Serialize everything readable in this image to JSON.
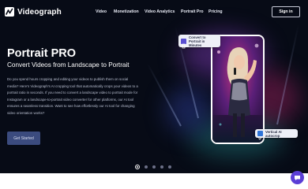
{
  "header": {
    "logo_text": "Videograph",
    "nav": [
      "Video",
      "Monetization",
      "Video Analytics",
      "Portrait Pro",
      "Pricing"
    ],
    "signin_label": "Sign in"
  },
  "hero": {
    "title": "Portrait PRO",
    "subtitle": "Convert Videos from Landscape to Portrait",
    "description": "Do you spend hours cropping and editing your videos to publish them on social media? Here's Videograph's AI cropping tool that automatically crops your videos to a portrait ratio in seconds. If you need to convert a landscape video to portrait mode for Instagram or a landscape-to-portrait video converter for other platforms, our AI tool ensures a seamless transition. Want to see how effortlessly our AI tool for changing video orientation works?",
    "cta_label": "Get Started"
  },
  "mockup": {
    "badge_top": "Convert to Portrait in Minutes",
    "badge_bottom": "Vertical AI autocrop"
  },
  "carousel": {
    "slides": 5,
    "active_index": 0
  },
  "colors": {
    "background": "#070b16",
    "cta": "#3b4b7e",
    "chat": "#5b3ed6",
    "badge_icon_top": "#5a4fd1",
    "badge_icon_bottom": "#2f74d8"
  },
  "icons": {
    "logo": "videograph-logo-icon",
    "badge_top": "portrait-crop-icon",
    "badge_bottom": "autocrop-icon",
    "chat": "chat-icon"
  }
}
